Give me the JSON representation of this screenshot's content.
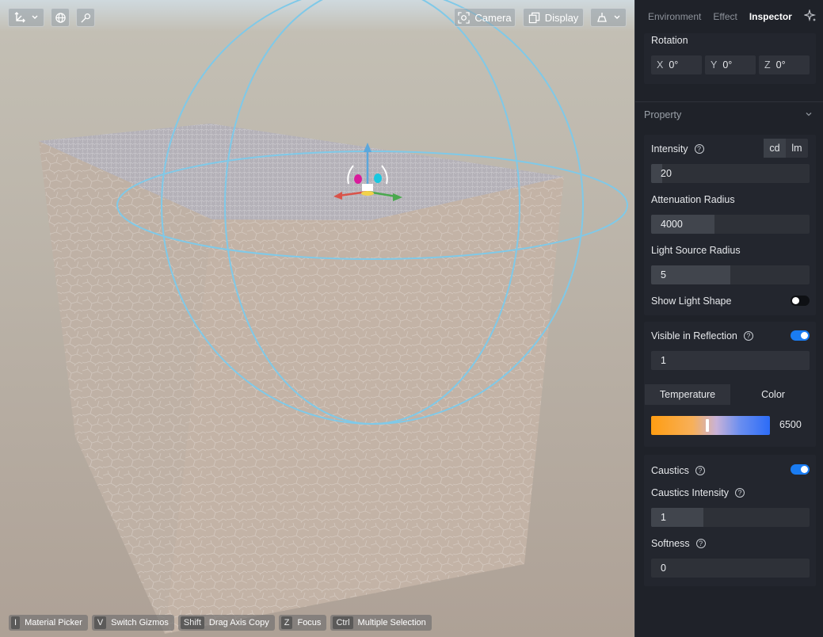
{
  "viewport": {
    "toolbar": {
      "camera_label": "Camera",
      "display_label": "Display"
    },
    "hotkeys": [
      {
        "key": "I",
        "label": "Material Picker"
      },
      {
        "key": "V",
        "label": "Switch Gizmos"
      },
      {
        "key": "Shift",
        "label": "Drag Axis Copy"
      },
      {
        "key": "Z",
        "label": "Focus"
      },
      {
        "key": "Ctrl",
        "label": "Multiple Selection"
      }
    ]
  },
  "panel": {
    "tabs": {
      "environment": "Environment",
      "effect": "Effect",
      "inspector": "Inspector",
      "active": "Inspector"
    },
    "rotation": {
      "label": "Rotation",
      "x_axis": "X",
      "x": "0°",
      "y_axis": "Y",
      "y": "0°",
      "z_axis": "Z",
      "z": "0°"
    },
    "property": {
      "title": "Property",
      "intensity": {
        "label": "Intensity",
        "value": "20",
        "fill_fraction": 0.07,
        "units": [
          "cd",
          "lm"
        ],
        "selected_unit": "cd"
      },
      "attenuation_radius": {
        "label": "Attenuation Radius",
        "value": "4000",
        "fill_fraction": 0.4
      },
      "light_source_radius": {
        "label": "Light Source Radius",
        "value": "5",
        "fill_fraction": 0.5
      },
      "show_light_shape": {
        "label": "Show Light Shape",
        "on": false
      },
      "visible_in_reflection": {
        "label": "Visible in Reflection",
        "on": true,
        "value": "1"
      },
      "color_tabs": [
        "Temperature",
        "Color"
      ],
      "selected_color_tab": "Temperature",
      "temperature": {
        "value": "6500",
        "marker_fraction": 0.47
      },
      "caustics": {
        "label": "Caustics",
        "on": true
      },
      "caustics_intensity": {
        "label": "Caustics Intensity",
        "value": "1",
        "fill_fraction": 0.33
      },
      "softness": {
        "label": "Softness",
        "value": "0"
      }
    }
  },
  "colors": {
    "accent": "#1a7cf2",
    "panel_bg": "#1f2229",
    "gizmo_ring": "#7fc9e8"
  }
}
